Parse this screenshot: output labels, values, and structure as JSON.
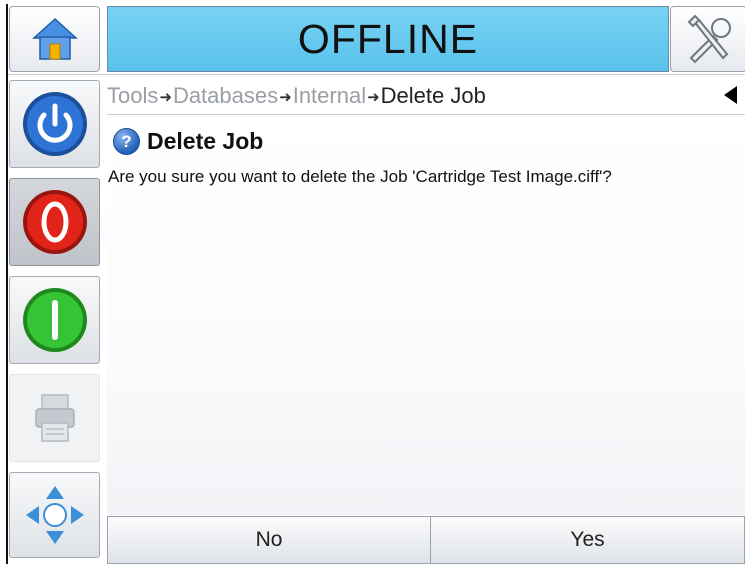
{
  "header": {
    "status_title": "OFFLINE"
  },
  "breadcrumb": [
    "Tools",
    "Databases",
    "Internal",
    "Delete Job"
  ],
  "dialog": {
    "title": "Delete Job",
    "message": "Are you sure you want to delete the Job 'Cartridge Test Image.ciff'?"
  },
  "actions": {
    "no_label": "No",
    "yes_label": "Yes"
  },
  "colors": {
    "status_bar": "#59c2ec",
    "power_blue": "#1c62c2",
    "stop_red": "#e2231a",
    "start_green": "#2fbf2f"
  },
  "icons": [
    "home-icon",
    "tools-icon",
    "power-icon",
    "stop-icon",
    "start-icon",
    "printer-icon",
    "navigate-icon",
    "back-arrow-icon",
    "question-icon"
  ]
}
